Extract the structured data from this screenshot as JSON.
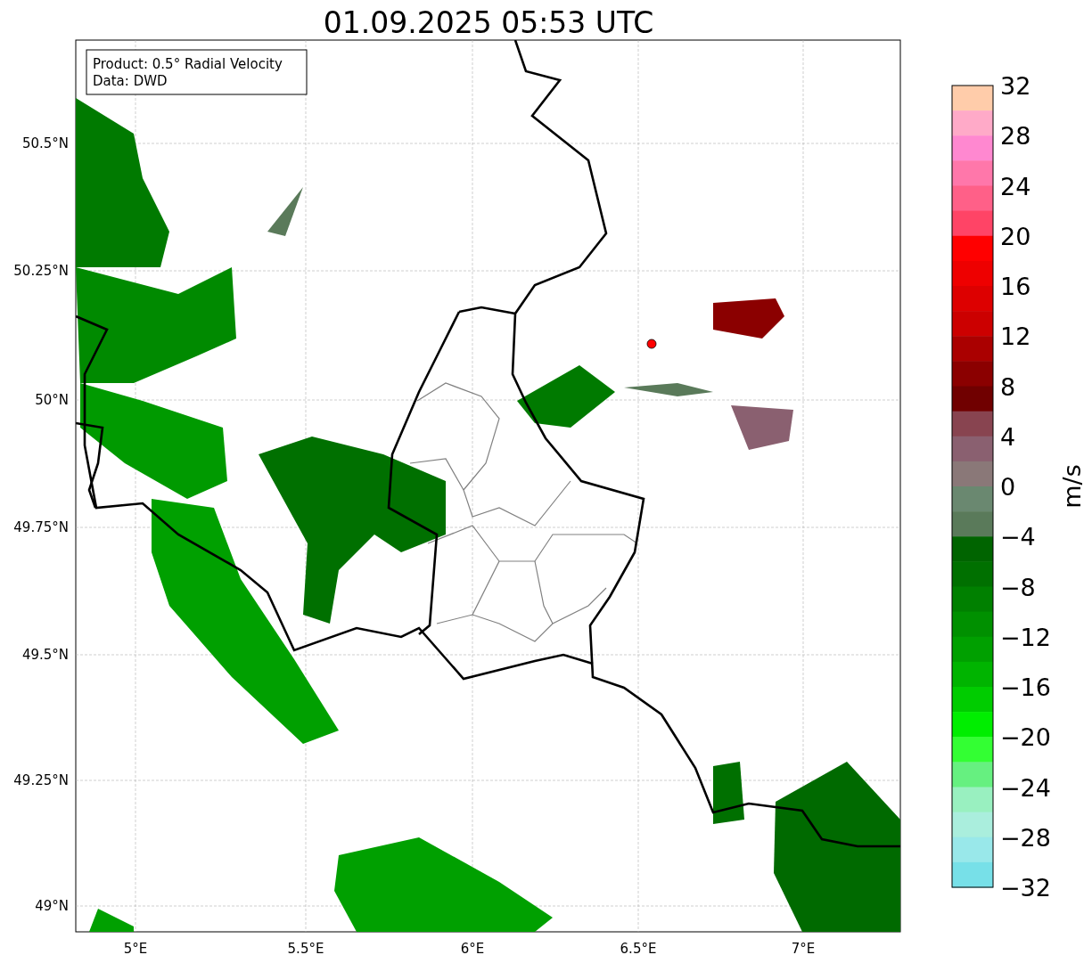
{
  "title": "01.09.2025 05:53 UTC",
  "legend": [
    "Product: 0.5° Radial Velocity",
    "Data: DWD"
  ],
  "x_ticks": [
    "5°E",
    "5.5°E",
    "6°E",
    "6.5°E",
    "7°E"
  ],
  "y_ticks": [
    "50.5°N",
    "50.25°N",
    "50°N",
    "49.75°N",
    "49.5°N",
    "49.25°N",
    "49°N"
  ],
  "colorbar": {
    "label": "m/s",
    "ticks": [
      "32",
      "28",
      "24",
      "20",
      "16",
      "12",
      "8",
      "4",
      "0",
      "−4",
      "−8",
      "−12",
      "−16",
      "−20",
      "−24",
      "−28",
      "−32"
    ],
    "bands": [
      {
        "color": "#ffccaa"
      },
      {
        "color": "#ffaac8"
      },
      {
        "color": "#ff88d0"
      },
      {
        "color": "#ff77aa"
      },
      {
        "color": "#ff6088"
      },
      {
        "color": "#ff4466"
      },
      {
        "color": "#ff0000"
      },
      {
        "color": "#ee0000"
      },
      {
        "color": "#dd0000"
      },
      {
        "color": "#cc0000"
      },
      {
        "color": "#aa0000"
      },
      {
        "color": "#8b0000"
      },
      {
        "color": "#700000"
      },
      {
        "color": "#884450"
      },
      {
        "color": "#8a6070"
      },
      {
        "color": "#8a7878"
      },
      {
        "color": "#6a8870"
      },
      {
        "color": "#5a7a5a"
      },
      {
        "color": "#006400"
      },
      {
        "color": "#007000"
      },
      {
        "color": "#008000"
      },
      {
        "color": "#009000"
      },
      {
        "color": "#00a000"
      },
      {
        "color": "#00b400"
      },
      {
        "color": "#00cc00"
      },
      {
        "color": "#00ee00"
      },
      {
        "color": "#33ff33"
      },
      {
        "color": "#66f080"
      },
      {
        "color": "#99f0c0"
      },
      {
        "color": "#aaeedd"
      },
      {
        "color": "#99e8ea"
      },
      {
        "color": "#77e0e8"
      }
    ]
  }
}
